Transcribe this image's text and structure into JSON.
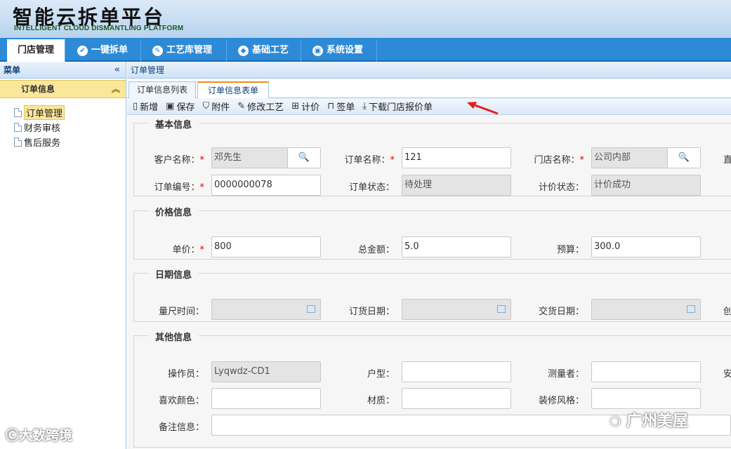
{
  "header": {
    "title": "智能云拆单平台",
    "subtitle": "INTELLIGENT CLOUD DISMANTLING PLATFORM"
  },
  "nav": {
    "items": [
      {
        "label": "门店管理",
        "icon": "none",
        "active": true
      },
      {
        "label": "一键拆单",
        "icon": "check-circle-icon"
      },
      {
        "label": "工艺库管理",
        "icon": "pencil-circle-icon"
      },
      {
        "label": "基础工艺",
        "icon": "tag-circle-icon"
      },
      {
        "label": "系统设置",
        "icon": "monitor-circle-icon"
      }
    ]
  },
  "sidebar": {
    "header": "菜单",
    "collapse_icon": "«",
    "group": "订单信息",
    "group_toggle_icon": "︽",
    "items": [
      {
        "label": "订单管理",
        "active": true
      },
      {
        "label": "财务审核"
      },
      {
        "label": "售后服务"
      }
    ]
  },
  "breadcrumb": "订单管理",
  "tabs": [
    {
      "label": "订单信息列表"
    },
    {
      "label": "订单信息表单",
      "active": true
    }
  ],
  "toolbar": {
    "new": "新增",
    "save": "保存",
    "attach": "附件",
    "modify": "修改工艺",
    "price": "计价",
    "sign": "签单",
    "download": "下载门店报价单"
  },
  "sections": {
    "basic": {
      "title": "基本信息",
      "customer_label": "客户名称：",
      "customer_value": "邓先生",
      "order_name_label": "订单名称：",
      "order_name_value": "121",
      "store_label": "门店名称：",
      "store_value": "公司内部",
      "order_no_label": "订单编号：",
      "order_no_value": "0000000078",
      "order_status_label": "订单状态：",
      "order_status_value": "待处理",
      "price_status_label": "计价状态：",
      "price_status_value": "计价成功",
      "cut_char": "直"
    },
    "price": {
      "title": "价格信息",
      "unit_label": "单价：",
      "unit_value": "800",
      "total_label": "总金额：",
      "total_value": "5.0",
      "budget_label": "预算：",
      "budget_value": "300.0"
    },
    "date": {
      "title": "日期信息",
      "measure_label": "量尺时间：",
      "order_date_label": "订货日期：",
      "delivery_label": "交货日期：",
      "cut_char": "创"
    },
    "other": {
      "title": "其他信息",
      "operator_label": "操作员：",
      "operator_value": "Lyqwdz-CD1",
      "house_label": "户型：",
      "house_value": "",
      "measurer_label": "测量者：",
      "measurer_value": "",
      "color_label": "喜欢颜色：",
      "color_value": "",
      "material_label": "材质：",
      "material_value": "",
      "style_label": "装修风格：",
      "style_value": "",
      "remark_label": "备注信息：",
      "remark_value": "",
      "cut_char": "安"
    }
  },
  "watermarks": {
    "left": "大数跨境",
    "right": "广州美屋"
  },
  "colors": {
    "nav": "#2d8ad6",
    "accent_tab": "#f08c1a",
    "highlight": "#fbe79a",
    "required": "#dd0000"
  }
}
